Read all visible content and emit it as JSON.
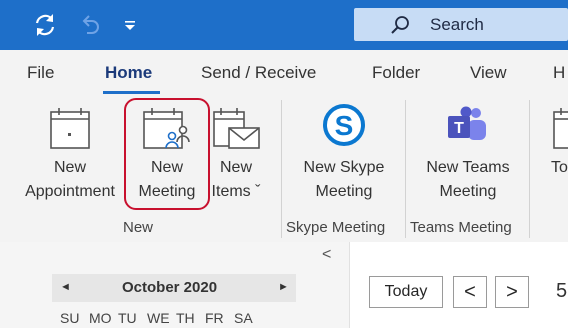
{
  "titlebar": {
    "search_label": "Search",
    "accent_color": "#1e6fc9",
    "icons": [
      "sync-icon",
      "undo-icon",
      "quick-access-dropdown-icon",
      "search-icon"
    ]
  },
  "tabs": [
    {
      "label": "File"
    },
    {
      "label": "Home",
      "active": true
    },
    {
      "label": "Send / Receive"
    },
    {
      "label": "Folder"
    },
    {
      "label": "View"
    },
    {
      "label": "H"
    }
  ],
  "ribbon": {
    "buttons": {
      "new_appointment": {
        "line1": "New",
        "line2": "Appointment"
      },
      "new_meeting": {
        "line1": "New",
        "line2": "Meeting"
      },
      "new_items": {
        "line1": "New",
        "line2": "Items ˇ"
      },
      "new_skype_meeting": {
        "line1": "New Skype",
        "line2": "Meeting"
      },
      "new_teams_meeting": {
        "line1": "New Teams",
        "line2": "Meeting"
      },
      "truncated": {
        "line1": "To"
      }
    },
    "groups": {
      "new": "New",
      "skype": "Skype Meeting",
      "teams": "Teams Meeting"
    }
  },
  "calendar": {
    "collapse_glyph": "<",
    "month_label": "October 2020",
    "prev_glyph": "◄",
    "next_glyph": "►",
    "weekdays": [
      "SU",
      "MO",
      "TU",
      "WE",
      "TH",
      "FR",
      "SA"
    ],
    "today_label": "Today",
    "back_glyph": "<",
    "forward_glyph": ">",
    "date_partial": "5"
  }
}
